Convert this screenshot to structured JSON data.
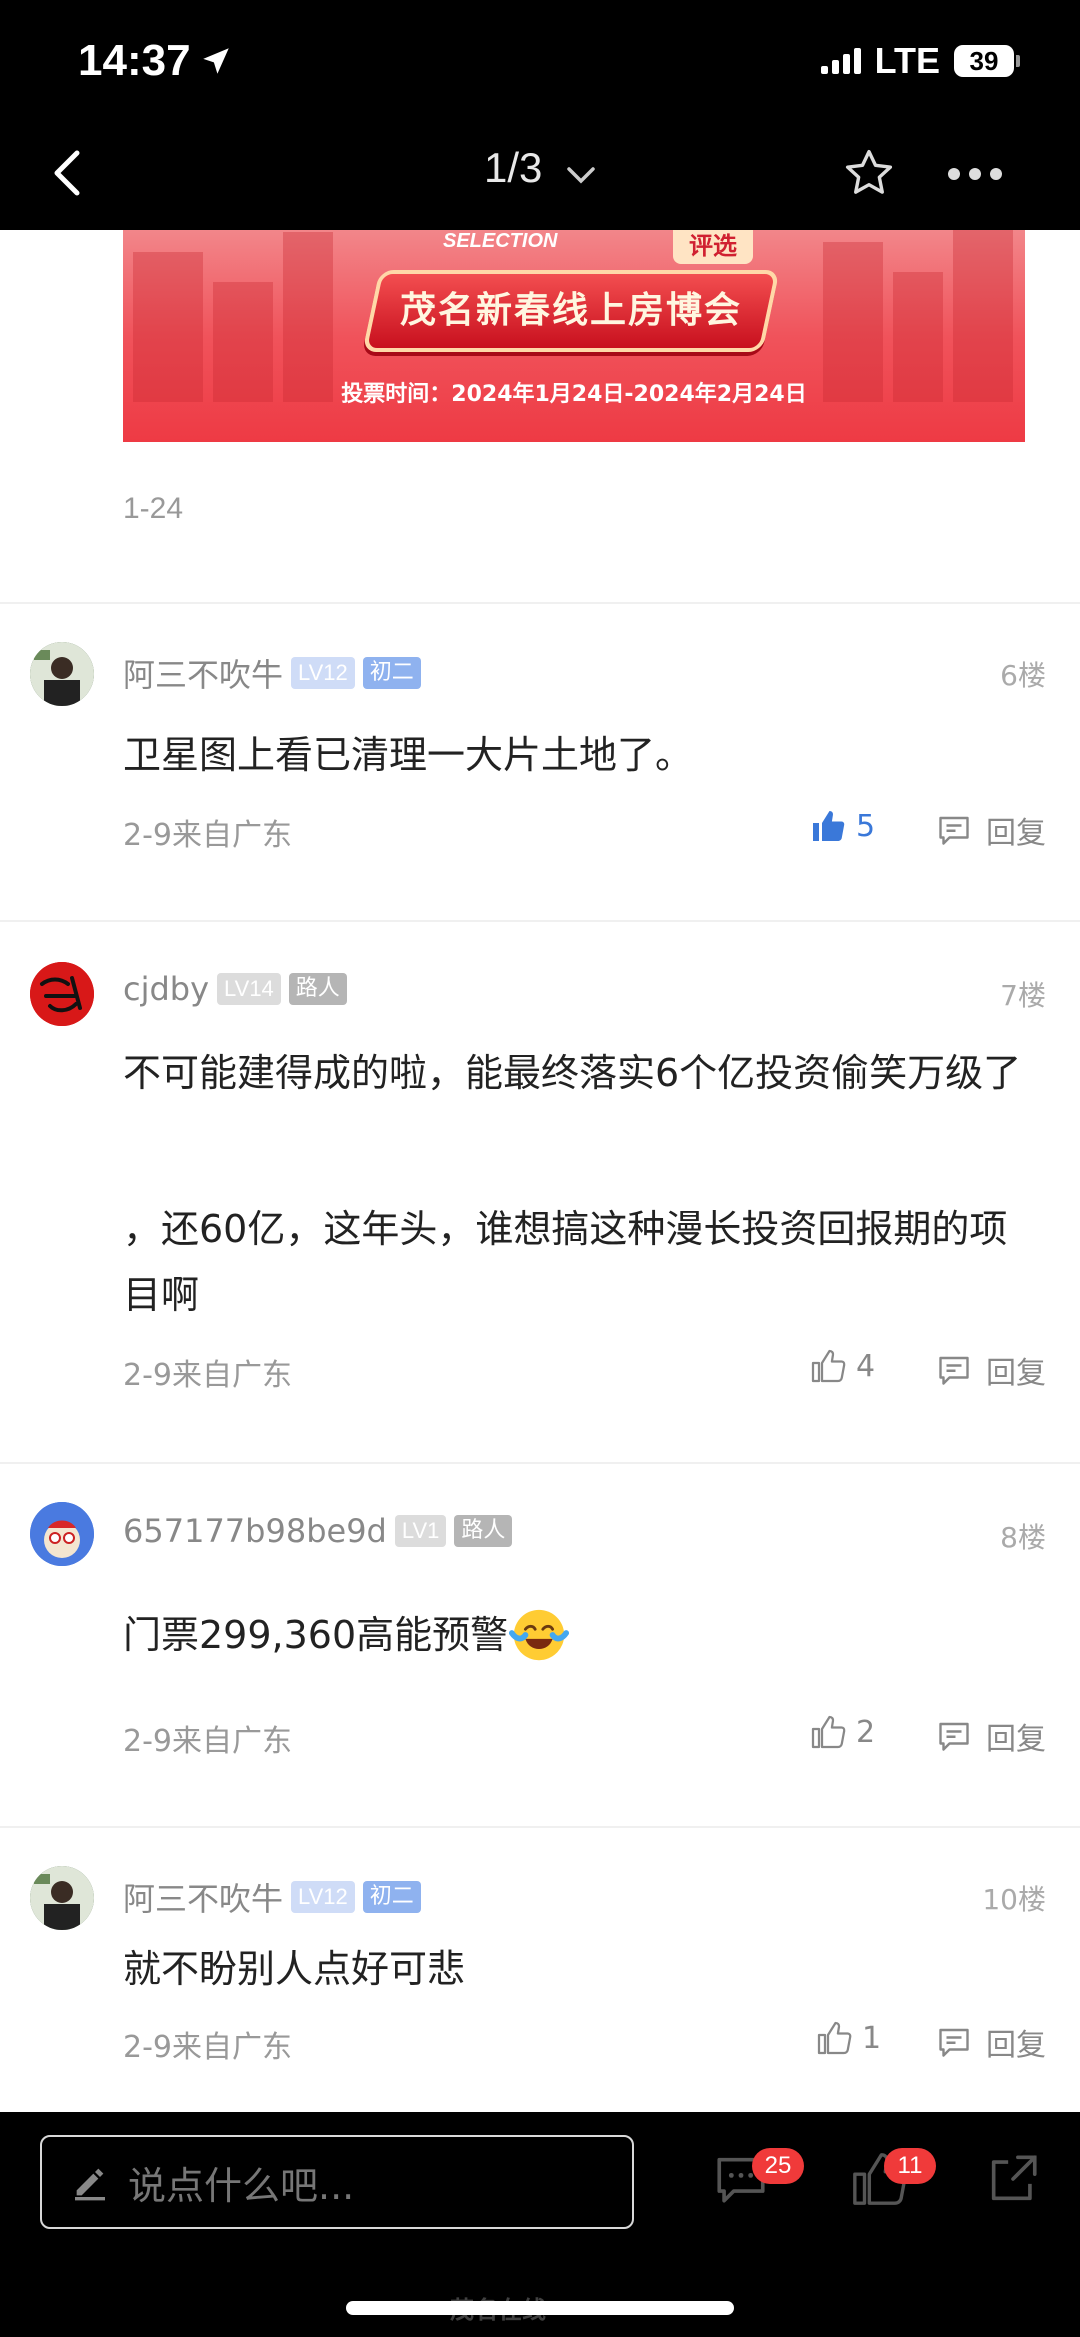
{
  "status_bar": {
    "time": "14:37",
    "network": "LTE",
    "battery": "39"
  },
  "nav": {
    "page_indicator": "1/3"
  },
  "banner": {
    "top_line": "SELECTION",
    "tag": "评选",
    "title": "茂名新春线上房博会",
    "vote_time": "投票时间：2024年1月24日-2024年2月24日"
  },
  "post": {
    "date": "1-24"
  },
  "comments": [
    {
      "user": "阿三不吹牛",
      "level": "LV12",
      "rank": "初二",
      "floor": "6楼",
      "text": "卫星图上看已清理一大片土地了。",
      "meta": "2-9来自广东",
      "likes": "5",
      "liked": true,
      "reply_label": "回复"
    },
    {
      "user": "cjdby",
      "level": "LV14",
      "rank": "路人",
      "floor": "7楼",
      "text": "不可能建得成的啦，能最终落实6个亿投资偷笑万级了",
      "text2": "，还60亿，这年头，谁想搞这种漫长投资回报期的项目啊",
      "meta": "2-9来自广东",
      "likes": "4",
      "liked": false,
      "reply_label": "回复"
    },
    {
      "user": "657177b98be9d",
      "level": "LV1",
      "rank": "路人",
      "floor": "8楼",
      "text": "门票299,360高能预警",
      "meta": "2-9来自广东",
      "likes": "2",
      "liked": false,
      "reply_label": "回复"
    },
    {
      "user": "阿三不吹牛",
      "level": "LV12",
      "rank": "初二",
      "floor": "10楼",
      "text": "就不盼别人点好可悲",
      "meta": "2-9来自广东",
      "likes": "1",
      "liked": false,
      "reply_label": "回复"
    }
  ],
  "bottom": {
    "input_placeholder": "说点什么吧...",
    "comment_count": "25",
    "like_count": "11",
    "watermark": "茂名在线"
  },
  "colors": {
    "like_active": "#3a78d9",
    "badge_red": "#f03a3a",
    "lv_blue": "#8fb2ef"
  }
}
